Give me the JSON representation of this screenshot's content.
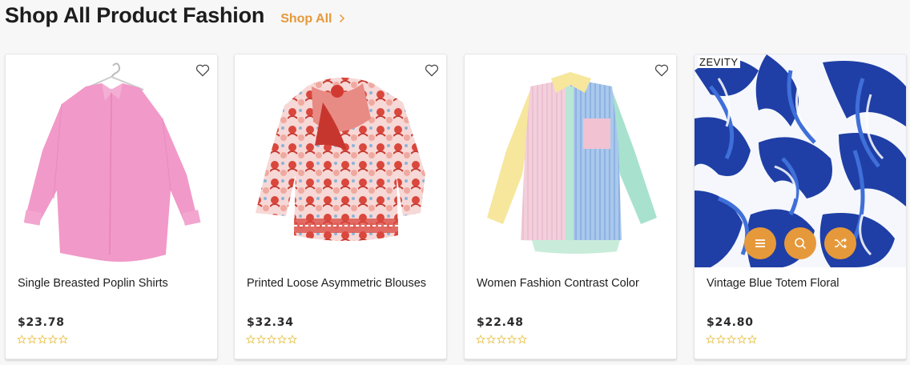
{
  "section": {
    "title": "Shop All Product Fashion",
    "shop_all_label": "Shop All"
  },
  "colors": {
    "accent": "#e6993a",
    "star_outline": "#e8c54e"
  },
  "products": [
    {
      "name": "Single Breasted Poplin Shirts",
      "price": "$23.78",
      "rating": 0,
      "image": "pink-shirt"
    },
    {
      "name": "Printed Loose Asymmetric Blouses",
      "price": "$32.34",
      "rating": 0,
      "image": "red-print-blouse"
    },
    {
      "name": "Women Fashion Contrast Color",
      "price": "$22.48",
      "rating": 0,
      "image": "pastel-colorblock-shirt"
    },
    {
      "name": "Vintage Blue Totem Floral",
      "price": "$24.80",
      "rating": 0,
      "image": "blue-totem-pattern",
      "brand_mark": "ZEVITY"
    }
  ],
  "hover_actions": [
    "menu-icon",
    "search-icon",
    "shuffle-icon"
  ]
}
